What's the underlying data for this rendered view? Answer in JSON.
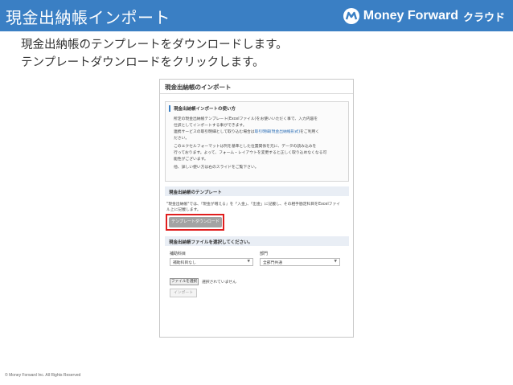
{
  "header": {
    "title": "現金出納帳インポート",
    "brand_name": "Money Forward",
    "brand_sub": "クラウド"
  },
  "instructions": [
    "現金出納帳のテンプレートをダウンロードします。",
    "テンプレートダウンロードをクリックします。"
  ],
  "screenshot": {
    "title": "現金出納帳のインポート",
    "help": {
      "heading": "現金出納帳インポートの使い方",
      "lines": [
        "所定の現金出納帳テンプレート(Excelファイル)をお使いいただく事で、入力内容を",
        "仕訳としてインポートする事ができます。",
        "連携サービスの取引明細として取り込む場合は",
        "ださい。",
        "このエクセルフォーマットは列を基準とした位置関係を元に、データの読み込みを",
        "行っております。よって、フォーム・レイアウトを変更すると正しく取り込めなくなる可",
        "能性がございます。",
        "他、詳しい使い方は右のスライドをご覧下さい。"
      ],
      "link_text": "取引明細(現金出納帳形式)",
      "link_suffix": "をご利用く"
    },
    "template": {
      "heading": "現金出納帳のテンプレート",
      "desc_lines": [
        "\"現金出納帳\"では、『現金が増える』を「入金」、「出金」に記載し、その相手勘定科目をExcelファイ",
        "ル上に記載します。"
      ],
      "download_button": "テンプレートダウンロード"
    },
    "file": {
      "heading": "現金出納帳ファイルを選択してください。",
      "account_label": "補助科目",
      "account_value": "補助科目なし",
      "dept_label": "部門",
      "dept_value": "全部門共通",
      "choose_button": "ファイルを選択",
      "no_file": "選択されていません",
      "import_button": "インポート"
    }
  },
  "footer": "© Money Forward Inc. All Rights Reserved",
  "colors": {
    "header_bg": "#3a7fc4",
    "highlight": "#e01e1e",
    "button_gray": "#a3a3a3"
  }
}
